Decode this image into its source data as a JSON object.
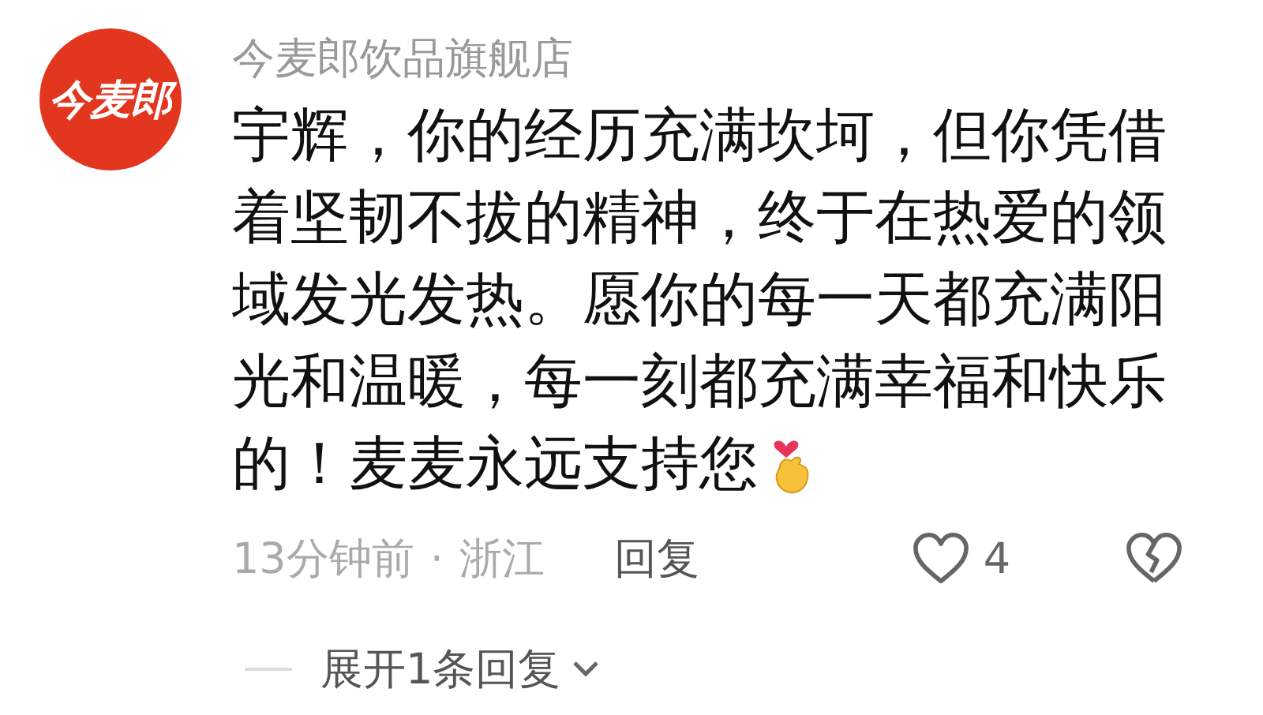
{
  "comment": {
    "avatar_text": "今麦郎",
    "author": "今麦郎饮品旗舰店",
    "text_lines": [
      "宇辉，你的经历充满坎坷，但你凭借",
      "着坚韧不拔的精神，终于在热爱的领",
      "域发光发热。愿你的每一天都充满阳",
      "光和温暖，每一刻都充满幸福和快乐",
      "的！麦麦永远支持您"
    ],
    "time": "13分钟前",
    "separator": "·",
    "location": "浙江",
    "reply_label": "回复",
    "likes": "4",
    "liked": false
  },
  "replies_toggle": {
    "label": "展开1条回复",
    "expanded": false
  }
}
